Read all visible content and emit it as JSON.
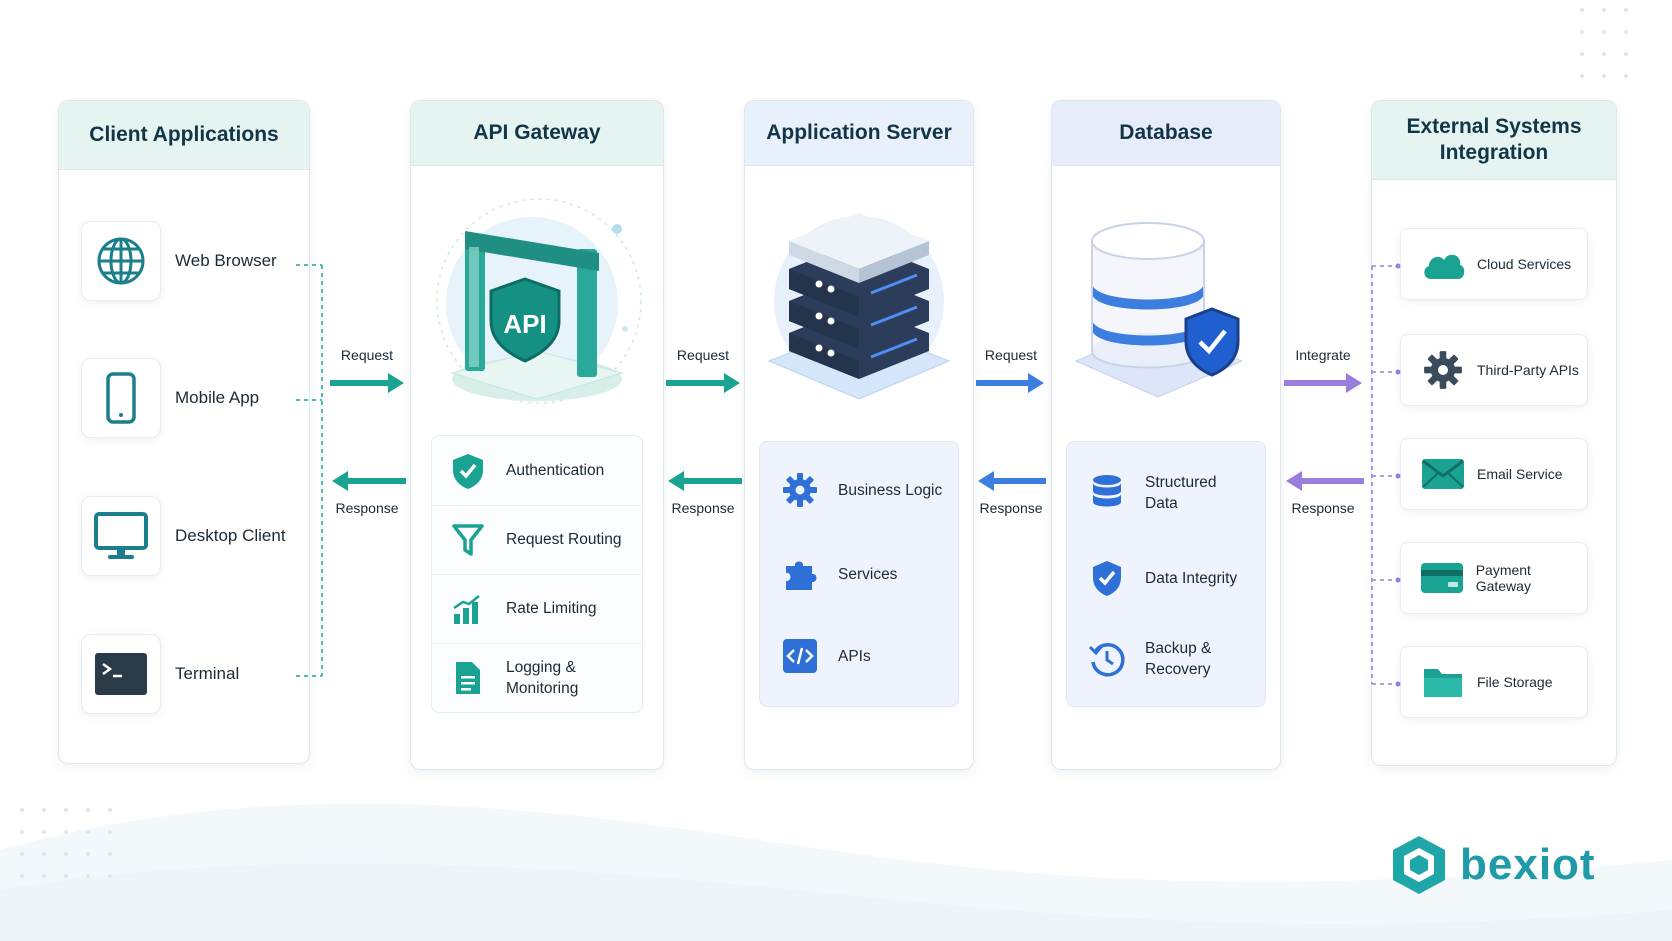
{
  "columns": {
    "client": {
      "title": "Client Applications"
    },
    "gateway": {
      "title": "API Gateway"
    },
    "appserver": {
      "title": "Application Server"
    },
    "database": {
      "title": "Database"
    },
    "external": {
      "title": "External Systems Integration"
    }
  },
  "client_items": [
    {
      "label": "Web Browser",
      "icon": "globe-icon"
    },
    {
      "label": "Mobile App",
      "icon": "smartphone-icon"
    },
    {
      "label": "Desktop Client",
      "icon": "monitor-icon"
    },
    {
      "label": "Terminal",
      "icon": "terminal-icon"
    }
  ],
  "gateway": {
    "badge_text": "API",
    "features": [
      {
        "label": "Authentication",
        "icon": "shield-check-icon"
      },
      {
        "label": "Request Routing",
        "icon": "funnel-icon"
      },
      {
        "label": "Rate Limiting",
        "icon": "bar-chart-icon"
      },
      {
        "label": "Logging & Monitoring",
        "icon": "document-icon"
      }
    ]
  },
  "appserver": {
    "features": [
      {
        "label": "Business Logic",
        "icon": "gear-icon"
      },
      {
        "label": "Services",
        "icon": "puzzle-icon"
      },
      {
        "label": "APIs",
        "icon": "code-icon"
      }
    ]
  },
  "database": {
    "features": [
      {
        "label": "Structured Data",
        "icon": "database-icon"
      },
      {
        "label": "Data Integrity",
        "icon": "shield-check-icon"
      },
      {
        "label": "Backup & Recovery",
        "icon": "history-icon"
      }
    ]
  },
  "external_items": [
    {
      "label": "Cloud Services",
      "icon": "cloud-icon"
    },
    {
      "label": "Third-Party APIs",
      "icon": "gear-icon"
    },
    {
      "label": "Email Service",
      "icon": "envelope-icon"
    },
    {
      "label": "Payment Gateway",
      "icon": "credit-card-icon"
    },
    {
      "label": "File Storage",
      "icon": "folder-icon"
    }
  ],
  "flows": [
    {
      "request": "Request",
      "response": "Response",
      "color": "#1aa393"
    },
    {
      "request": "Request",
      "response": "Response",
      "color": "#1aa393"
    },
    {
      "request": "Request",
      "response": "Response",
      "color": "#3b7ee0"
    },
    {
      "request": "Integrate",
      "response": "Response",
      "color": "#9a7ddc"
    }
  ],
  "brand": {
    "name": "bexiot",
    "color": "#1f9aa8"
  },
  "colors": {
    "teal": "#1aa393",
    "blue": "#3b7ee0",
    "navy": "#1f3550",
    "purple": "#9a7ddc"
  }
}
